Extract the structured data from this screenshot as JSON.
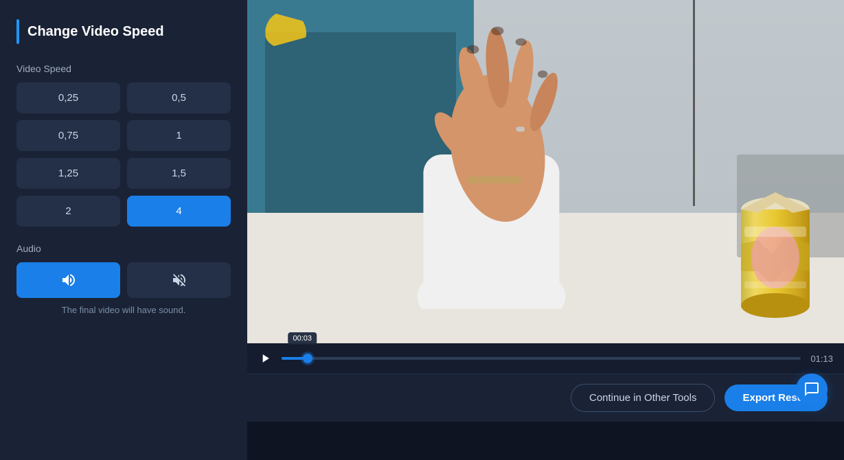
{
  "panel": {
    "title": "Change Video Speed",
    "speed_label": "Video Speed",
    "speed_options": [
      {
        "value": "0,25",
        "active": false
      },
      {
        "value": "0,5",
        "active": false
      },
      {
        "value": "0,75",
        "active": false
      },
      {
        "value": "1",
        "active": false
      },
      {
        "value": "1,25",
        "active": false
      },
      {
        "value": "1,5",
        "active": false
      },
      {
        "value": "2",
        "active": false
      },
      {
        "value": "4",
        "active": true
      }
    ],
    "audio_label": "Audio",
    "audio_on_icon": "🔊",
    "audio_off_icon": "🔇",
    "audio_note": "The final video will have sound."
  },
  "player": {
    "current_time": "00:03",
    "total_time": "01:13",
    "progress_percent": 5
  },
  "footer": {
    "continue_label": "Continue in Other Tools",
    "export_label": "Export Result"
  },
  "colors": {
    "accent": "#1a7fe8",
    "bg_dark": "#0e1422",
    "bg_panel": "#1a2235",
    "bg_card": "#243047"
  }
}
